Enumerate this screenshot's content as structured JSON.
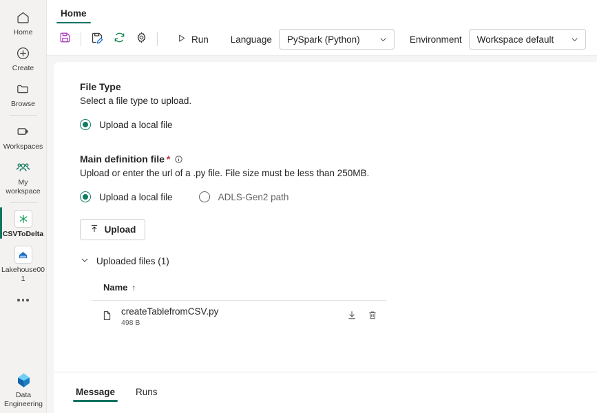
{
  "sidebar": {
    "items": [
      {
        "label": "Home",
        "icon": "home-icon"
      },
      {
        "label": "Create",
        "icon": "plus-circle-icon"
      },
      {
        "label": "Browse",
        "icon": "folder-icon"
      },
      {
        "label": "Workspaces",
        "icon": "workspaces-icon"
      },
      {
        "label": "My workspace",
        "icon": "people-icon"
      },
      {
        "label": "CSVToDelta",
        "icon": "spark-job-icon"
      },
      {
        "label": "Lakehouse001",
        "icon": "lakehouse-icon"
      }
    ],
    "more_label": "more-options",
    "footer": {
      "label": "Data Engineering",
      "icon": "data-engineering-icon"
    }
  },
  "ribbon": {
    "tabs": [
      {
        "label": "Home",
        "active": true
      }
    ]
  },
  "toolbar": {
    "save_icon": "save-icon",
    "save_as_icon": "save-as-edit-icon",
    "refresh_icon": "refresh-icon",
    "settings_icon": "gear-icon",
    "run_label": "Run",
    "run_icon": "play-icon",
    "language_label": "Language",
    "language_value": "PySpark (Python)",
    "environment_label": "Environment",
    "environment_value": "Workspace default"
  },
  "file_type": {
    "title": "File Type",
    "description": "Select a file type to upload.",
    "options": [
      {
        "label": "Upload a local file",
        "selected": true
      }
    ]
  },
  "main_definition": {
    "title": "Main definition file",
    "required_marker": "*",
    "info_icon": "info-icon",
    "description": "Upload or enter the url of a .py file. File size must be less than 250MB.",
    "options": [
      {
        "label": "Upload a local file",
        "selected": true
      },
      {
        "label": "ADLS-Gen2 path",
        "selected": false
      }
    ],
    "upload_button": "Upload",
    "uploaded_files_label": "Uploaded files (1)",
    "table": {
      "columns": [
        "Name"
      ],
      "sort_indicator": "↑",
      "rows": [
        {
          "file_icon": "document-icon",
          "name": "createTablefromCSV.py",
          "size": "498 B",
          "download_icon": "download-icon",
          "delete_icon": "trash-icon"
        }
      ]
    }
  },
  "bottom_tabs": [
    {
      "label": "Message",
      "active": true
    },
    {
      "label": "Runs",
      "active": false
    }
  ],
  "colors": {
    "accent_teal": "#0f7362",
    "radio_green": "#107c61",
    "required_red": "#c4314b",
    "save_purple": "#b146c2",
    "refresh_green": "#1a8a52",
    "pencil_blue": "#1f6fd0",
    "lakehouse_blue": "#1b6ec2",
    "sidebar_bg": "#f3f2f1",
    "canvas_bg": "#f5f5f5"
  }
}
